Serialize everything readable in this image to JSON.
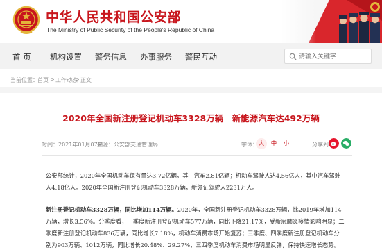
{
  "header": {
    "title_cn": "中华人民共和国公安部",
    "title_en": "The Ministry of Public Security of the People's Republic of China",
    "colors": {
      "brand_red": "#c8161d",
      "gold": "#e4b53a"
    }
  },
  "nav": {
    "items": [
      {
        "label": "首  页"
      },
      {
        "label": "机构设置"
      },
      {
        "label": "警务信息"
      },
      {
        "label": "办事服务"
      },
      {
        "label": "警民互动"
      }
    ],
    "search_placeholder": "请输入关键字"
  },
  "breadcrumb": {
    "prefix": "当前位置：",
    "items": [
      "首页",
      "工作动态",
      "正文"
    ],
    "separator": ">"
  },
  "article": {
    "title": "2020年全国新注册登记机动车3328万辆　新能源汽车达492万辆",
    "date": "时间：2021年01月07日",
    "source": "来源：公安部交通管理局",
    "font_label": "字体：",
    "font_sizes": [
      "大",
      "中",
      "小"
    ],
    "share_label": "分享到：",
    "share_icons": [
      "weibo-icon",
      "wechat-icon"
    ],
    "para1": "公安部统计，2020年全国机动车保有量达3.72亿辆，其中汽车2.81亿辆；机动车驾驶人达4.56亿人，其中汽车驾驶人4.18亿人。2020年全国新注册登记机动车3328万辆，新领证驾驶人2231万人。",
    "para2_bold": "新注册登记机动车3328万辆，同比增加114万辆。",
    "para2_rest": "2020年，全国新注册登记机动车3328万辆，比2019年增加114万辆，增长3.56%。分季度看，一季度新注册登记机动车577万辆，同比下降21.17%，受新冠肺炎疫情影响明显；二季度新注册登记机动车836万辆，同比增长7.18%，机动车消费市场开始复苏；三季度、四季度新注册登记机动车分别为903万辆、1012万辆，同比增长20.48%、29.27%，三四季度机动车消费市场明显反弹，保持快速增长态势。"
  }
}
